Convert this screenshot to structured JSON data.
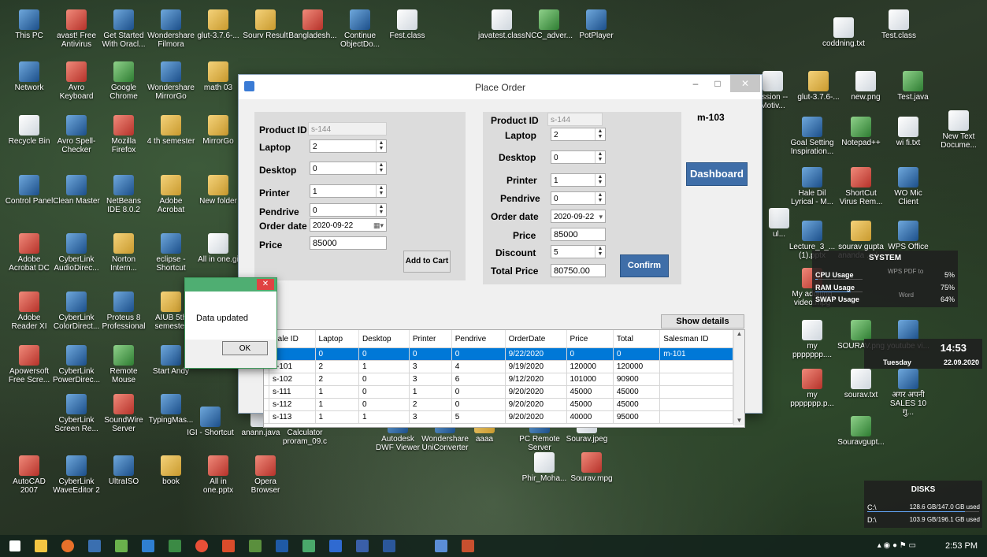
{
  "desktop": {
    "icons": [
      {
        "label": "This PC",
        "kind": "b"
      },
      {
        "label": "avast! Free Antivirus",
        "kind": "r"
      },
      {
        "label": "Get Started With Oracl...",
        "kind": "b"
      },
      {
        "label": "Wondershare Filmora",
        "kind": "b"
      },
      {
        "label": "glut-3.7.6-...",
        "kind": "y"
      },
      {
        "label": "Sourv Result",
        "kind": "y"
      },
      {
        "label": "Bangladesh...",
        "kind": "r"
      },
      {
        "label": "Continue ObjectDo...",
        "kind": "b"
      },
      {
        "label": "Fest.class",
        "kind": "w"
      },
      {
        "label": "javatest.class",
        "kind": "w"
      },
      {
        "label": "NCC_adver...",
        "kind": "g"
      },
      {
        "label": "PotPlayer",
        "kind": "b"
      },
      {
        "label": "coddning.txt",
        "kind": "w"
      },
      {
        "label": "Test.class",
        "kind": "w"
      },
      {
        "label": "Network",
        "kind": "b"
      },
      {
        "label": "Avro Keyboard",
        "kind": "r"
      },
      {
        "label": "Google Chrome",
        "kind": "g"
      },
      {
        "label": "Wondershare MirrorGo",
        "kind": "b"
      },
      {
        "label": "math 03",
        "kind": "y"
      },
      {
        "label": "Recycle Bin",
        "kind": "w"
      },
      {
        "label": "Avro Spell-Checker",
        "kind": "b"
      },
      {
        "label": "Mozilla Firefox",
        "kind": "r"
      },
      {
        "label": "4 th semester",
        "kind": "y"
      },
      {
        "label": "MirrorGo",
        "kind": "y"
      },
      {
        "label": "Control Panel",
        "kind": "b"
      },
      {
        "label": "Clean Master",
        "kind": "b"
      },
      {
        "label": "NetBeans IDE 8.0.2",
        "kind": "b"
      },
      {
        "label": "Adobe Acrobat",
        "kind": "y"
      },
      {
        "label": "New folder",
        "kind": "y"
      },
      {
        "label": "Adobe Acrobat DC",
        "kind": "r"
      },
      {
        "label": "CyberLink AudioDirec...",
        "kind": "b"
      },
      {
        "label": "Norton Intern...",
        "kind": "y"
      },
      {
        "label": "eclipse - Shortcut",
        "kind": "b"
      },
      {
        "label": "All in one.gi",
        "kind": "w"
      },
      {
        "label": "Adobe Reader XI",
        "kind": "r"
      },
      {
        "label": "CyberLink ColorDirect...",
        "kind": "b"
      },
      {
        "label": "Proteus 8 Professional",
        "kind": "b"
      },
      {
        "label": "AIUB 5th semester",
        "kind": "y"
      },
      {
        "label": "Apowersoft Free Scre...",
        "kind": "r"
      },
      {
        "label": "CyberLink PowerDirec...",
        "kind": "b"
      },
      {
        "label": "Remote Mouse",
        "kind": "g"
      },
      {
        "label": "Start Andy",
        "kind": "b"
      },
      {
        "label": "CyberLink Screen Re...",
        "kind": "b"
      },
      {
        "label": "SoundWire Server",
        "kind": "r"
      },
      {
        "label": "TypingMas...",
        "kind": "b"
      },
      {
        "label": "IGI - Shortcut",
        "kind": "b"
      },
      {
        "label": "anann.java",
        "kind": "w"
      },
      {
        "label": "Calculator proram_09.c",
        "kind": "w"
      },
      {
        "label": "Autodesk DWF Viewer",
        "kind": "b"
      },
      {
        "label": "Wondershare UniConverter",
        "kind": "b"
      },
      {
        "label": "aaaa",
        "kind": "y"
      },
      {
        "label": "PC Remote Server",
        "kind": "b"
      },
      {
        "label": "Sourav.jpeg",
        "kind": "w"
      },
      {
        "label": "AutoCAD 2007",
        "kind": "r"
      },
      {
        "label": "CyberLink WaveEditor 2",
        "kind": "b"
      },
      {
        "label": "UltraISO",
        "kind": "b"
      },
      {
        "label": "book",
        "kind": "y"
      },
      {
        "label": "All in one.pptx",
        "kind": "r"
      },
      {
        "label": "Opera Browser",
        "kind": "r"
      },
      {
        "label": "Phir_Moha...",
        "kind": "w"
      },
      {
        "label": "Sourav.mpg",
        "kind": "r"
      },
      {
        "label": "ession -- Motiv...",
        "kind": "w"
      },
      {
        "label": "glut-3.7.6-...",
        "kind": "y"
      },
      {
        "label": "new.png",
        "kind": "w"
      },
      {
        "label": "Test.java",
        "kind": "g"
      },
      {
        "label": "Goal Setting Inspiration...",
        "kind": "b"
      },
      {
        "label": "Notepad++",
        "kind": "g"
      },
      {
        "label": "wi fi.txt",
        "kind": "w"
      },
      {
        "label": "New Text Docume...",
        "kind": "w"
      },
      {
        "label": "Hale Dil Lyrical - M...",
        "kind": "b"
      },
      {
        "label": "ShortCut Virus Rem...",
        "kind": "r"
      },
      {
        "label": "WO Mic Client",
        "kind": "b"
      },
      {
        "label": "ul...",
        "kind": "w"
      },
      {
        "label": "Lecture_3_... (1).pptx",
        "kind": "b"
      },
      {
        "label": "sourav gupta ananda .rol...",
        "kind": "y"
      },
      {
        "label": "WPS Office",
        "kind": "b"
      },
      {
        "label": "My additing video.mpg",
        "kind": "r"
      },
      {
        "label": "my ppppppp....",
        "kind": "w"
      },
      {
        "label": "SOURAV.png",
        "kind": "g"
      },
      {
        "label": "youtube vi...",
        "kind": "b"
      },
      {
        "label": "my ppppppp.p...",
        "kind": "r"
      },
      {
        "label": "sourav.txt",
        "kind": "w"
      },
      {
        "label": "अगर अपनी SALES 10 गु...",
        "kind": "b"
      },
      {
        "label": "Souravgupt...",
        "kind": "g"
      }
    ]
  },
  "window": {
    "title": "Place Order",
    "minimize": "–",
    "maximize": "□",
    "close": "✕"
  },
  "left_form": {
    "product_id_label": "Product ID",
    "product_id_value": "s-144",
    "laptop_label": "Laptop",
    "laptop_value": "2",
    "desktop_label": "Desktop",
    "desktop_value": "0",
    "printer_label": "Printer",
    "printer_value": "1",
    "pendrive_label": "Pendrive",
    "pendrive_value": "0",
    "order_date_label": "Order date",
    "order_date_value": "2020-09-22",
    "price_label": "Price",
    "price_value": "85000",
    "add_to_cart": "Add to Cart"
  },
  "right_form": {
    "product_id_label": "Product ID",
    "product_id_value": "s-144",
    "laptop_label": "Laptop",
    "laptop_value": "2",
    "desktop_label": "Desktop",
    "desktop_value": "0",
    "printer_label": "Printer",
    "printer_value": "1",
    "pendrive_label": "Pendrive",
    "pendrive_value": "0",
    "order_date_label": "Order date",
    "order_date_value": "2020-09-22",
    "price_label": "Price",
    "price_value": "85000",
    "discount_label": "Discount",
    "discount_value": "5",
    "total_price_label": "Total Price",
    "total_price_value": "80750.00",
    "confirm": "Confirm"
  },
  "salesman_code": "m-103",
  "dashboard": "Dashboard",
  "show_details": "Show details",
  "grid": {
    "columns": [
      "Sale ID",
      "Laptop",
      "Desktop",
      "Printer",
      "Pendrive",
      "OrderDate",
      "Price",
      "Total",
      "Salesman ID"
    ],
    "rows": [
      [
        "",
        "0",
        "0",
        "0",
        "0",
        "9/22/2020",
        "0",
        "0",
        "m-101"
      ],
      [
        "s-101",
        "2",
        "1",
        "3",
        "4",
        "9/19/2020",
        "120000",
        "120000",
        ""
      ],
      [
        "s-102",
        "2",
        "0",
        "3",
        "6",
        "9/12/2020",
        "101000",
        "90900",
        ""
      ],
      [
        "s-111",
        "1",
        "0",
        "1",
        "0",
        "9/20/2020",
        "45000",
        "45000",
        ""
      ],
      [
        "s-112",
        "1",
        "0",
        "2",
        "0",
        "9/20/2020",
        "45000",
        "45000",
        ""
      ],
      [
        "s-113",
        "1",
        "1",
        "3",
        "5",
        "9/20/2020",
        "40000",
        "95000",
        ""
      ]
    ],
    "selected_row": 0
  },
  "message_box": {
    "text": "Data updated",
    "ok": "OK",
    "close": "✕"
  },
  "system_widget": {
    "title": "SYSTEM",
    "cpu_label": "CPU Usage",
    "cpu_value": "5%",
    "ram_label": "RAM Usage",
    "ram_value": "75%",
    "swap_label": "SWAP Usage",
    "swap_value": "64%",
    "cpu_level": 0.05,
    "ram_level": 0.75,
    "swap_level": 0.64,
    "overlay_1": "WPS PDF to",
    "overlay_2": "Word"
  },
  "clock_widget": {
    "time": "14:53",
    "day": "Tuesday",
    "date": "22.09.2020"
  },
  "disks_widget": {
    "title": "DISKS",
    "c_label": "C:\\",
    "c_value": "128.6 GB/147.0 GB used",
    "d_label": "D:\\",
    "d_value": "103.9 GB/196.1 GB used",
    "c_level": 0.875,
    "d_level": 0.53
  },
  "taskbar": {
    "time": "2:53 PM"
  },
  "colors": {
    "accent": "#0078d7",
    "button_blue": "#3f6ea8",
    "msg_green": "#4fae72"
  }
}
